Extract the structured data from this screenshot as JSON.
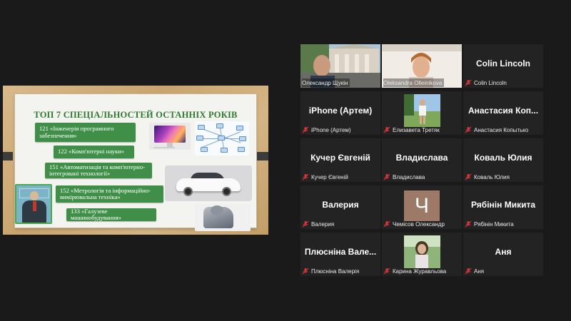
{
  "slide": {
    "title": "ТОП 7 СПЕЦІАЛЬНОСТЕЙ ОСТАННІХ РОКІВ",
    "items": [
      "121 «Інженерія програмного забезпечення»",
      "122 «Комп'ютерні науки»",
      "151 «Автоматизація та комп'ютерно-інтегровані технології»",
      "152 «Метрологія та інформаційно-вимірювальна техніка»",
      "133 «Галузеве машинобудування»"
    ]
  },
  "participants": [
    {
      "name": "",
      "label": "Олександр Щукін",
      "muted": false,
      "video": true,
      "active": true
    },
    {
      "name": "",
      "label": "Oleksandra Olleinikova",
      "muted": false,
      "video": true
    },
    {
      "name": "Colin Lincoln",
      "label": "Colin Lincoln",
      "muted": true
    },
    {
      "name": "iPhone (Артем)",
      "label": "iPhone (Артем)",
      "muted": true
    },
    {
      "name": "",
      "label": "Елизавета Третяк",
      "muted": true,
      "photo": true
    },
    {
      "name": "Анастасия  Коп...",
      "label": "Анастасия Копытько",
      "muted": true
    },
    {
      "name": "Кучер Євгеній",
      "label": "Кучер Євгеній",
      "muted": true
    },
    {
      "name": "Владислава",
      "label": "Владислава",
      "muted": true
    },
    {
      "name": "Коваль Юлия",
      "label": "Коваль Юлия",
      "muted": true
    },
    {
      "name": "Валерия",
      "label": "Валерия",
      "muted": true
    },
    {
      "name": "",
      "label": "Чемісов Олександр",
      "muted": true,
      "avatar_letter": "Ч"
    },
    {
      "name": "Рябінін Микита",
      "label": "Рябінін Микита",
      "muted": true
    },
    {
      "name": "Плюсніна  Вале...",
      "label": "Плюсніна Валерія",
      "muted": true
    },
    {
      "name": "",
      "label": "Карина Журавльова",
      "muted": true,
      "photo": true
    },
    {
      "name": "Аня",
      "label": "Аня",
      "muted": true
    }
  ],
  "colors": {
    "background": "#1a1a1a",
    "tile": "#232323",
    "active_border": "#d5e24b",
    "muted_icon": "#e0353b",
    "slide_green": "#3f8f49"
  },
  "icons": {
    "muted": "mic-muted-icon"
  }
}
